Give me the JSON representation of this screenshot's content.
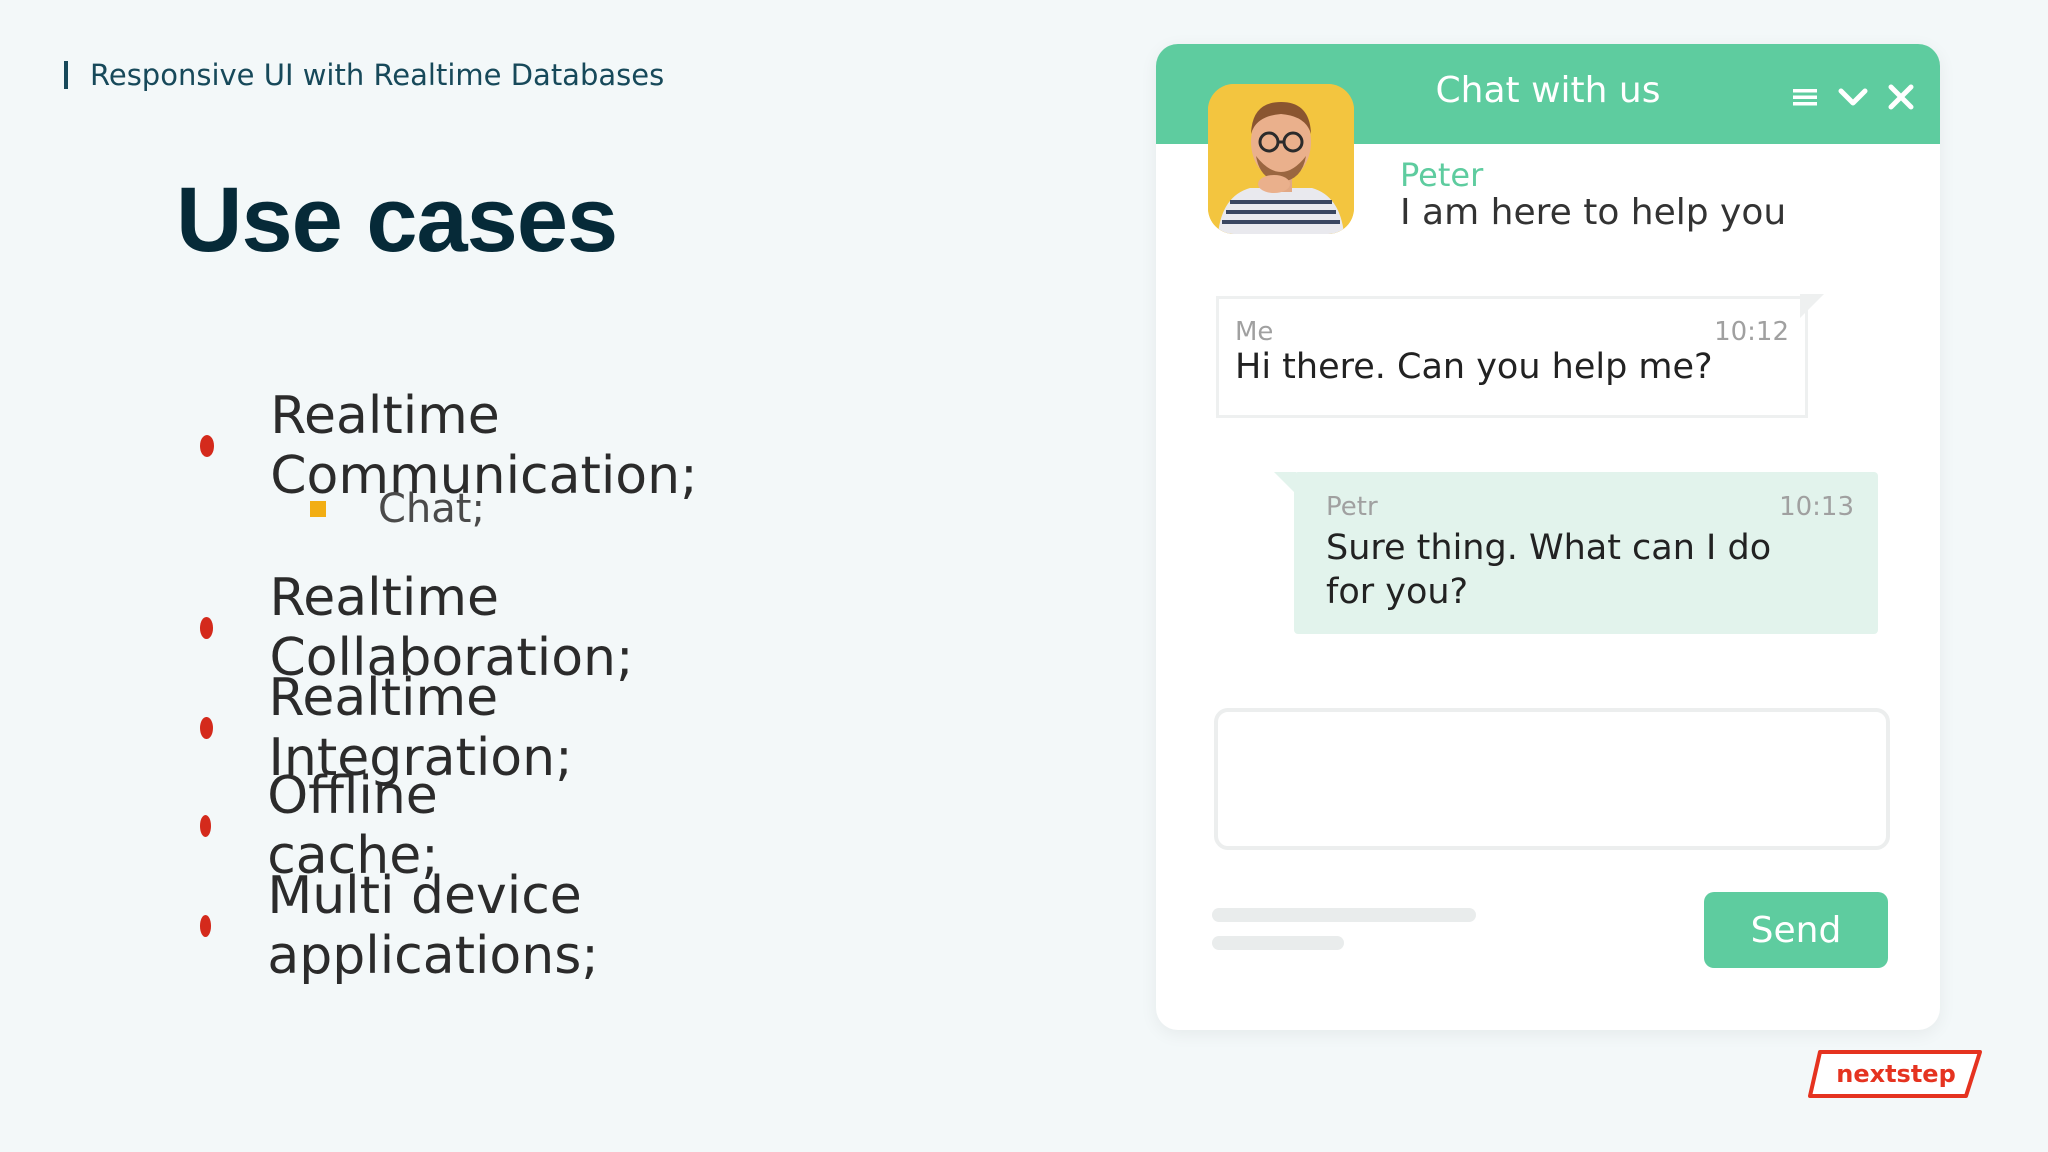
{
  "header": {
    "text": "Responsive UI with Realtime Databases"
  },
  "title": "Use cases",
  "bullets": [
    {
      "label": "Realtime Communication;"
    },
    {
      "label": "Realtime Collaboration;"
    },
    {
      "label": "Realtime Integration;"
    },
    {
      "label": "Offline cache;"
    },
    {
      "label": "Multi device applications;"
    }
  ],
  "sub_bullets": [
    {
      "label": "Chat;"
    }
  ],
  "chat": {
    "title": "Chat with us",
    "agent": {
      "name": "Peter",
      "status": "I am here to help you"
    },
    "messages": [
      {
        "sender": "Me",
        "time": "10:12",
        "text": "Hi there. Can you help me?"
      },
      {
        "sender": "Petr",
        "time": "10:13",
        "text_line1": "Sure thing. What can I do",
        "text_line2": "for you?"
      }
    ],
    "input_value": "",
    "send_label": "Send",
    "icons": [
      "menu-icon",
      "chevron-down-icon",
      "close-icon"
    ]
  },
  "logo": {
    "text": "nextstep"
  },
  "colors": {
    "accent_green": "#5ecc9f",
    "bullet_red": "#d42a1c",
    "sub_bullet_yellow": "#f2ae14",
    "title_dark": "#062a38",
    "logo_red": "#e53320"
  }
}
